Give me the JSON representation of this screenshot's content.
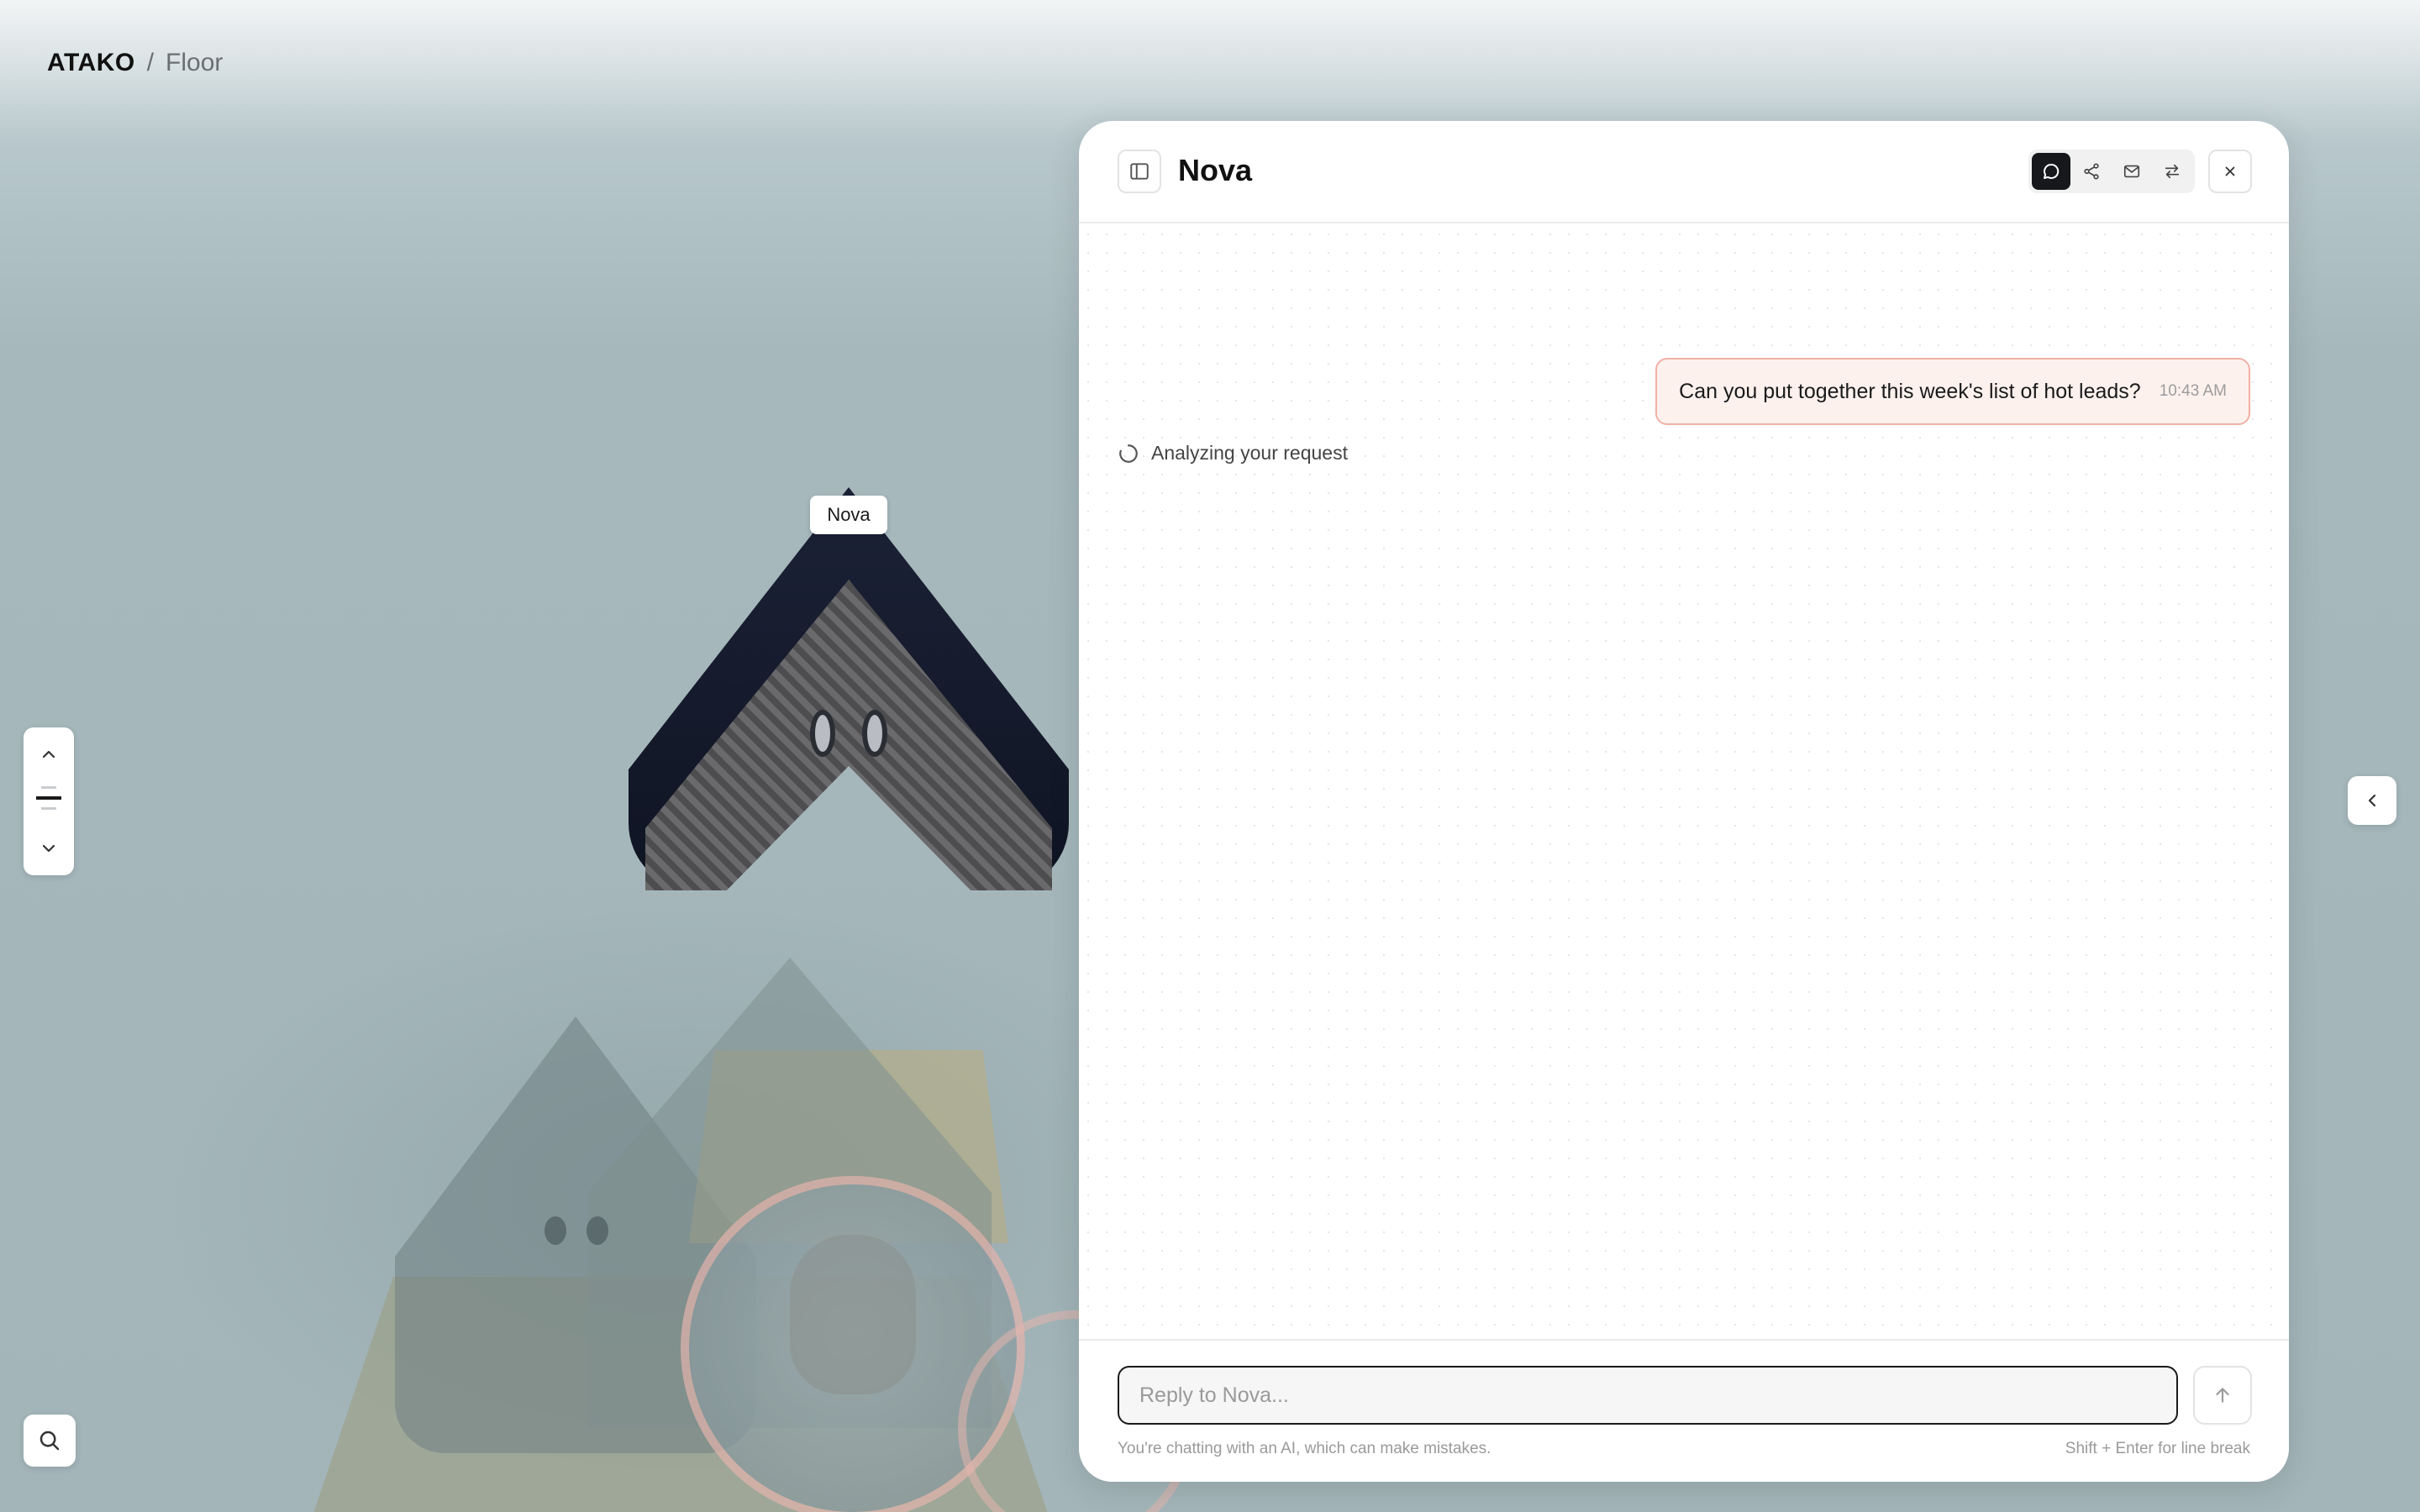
{
  "breadcrumb": {
    "root": "ATAKO",
    "separator": "/",
    "page": "Floor"
  },
  "scene": {
    "robot_label": "Nova"
  },
  "scroll_control": {
    "up_icon": "chevron-up-icon",
    "down_icon": "chevron-down-icon"
  },
  "search": {
    "icon": "search-icon"
  },
  "edge_toggle": {
    "icon": "chevron-left-icon"
  },
  "chat": {
    "title": "Nova",
    "modes": [
      {
        "name": "chat",
        "icon": "chat-bubble-icon",
        "active": true
      },
      {
        "name": "share",
        "icon": "share-icon",
        "active": false
      },
      {
        "name": "mail",
        "icon": "mail-icon",
        "active": false
      },
      {
        "name": "transfer",
        "icon": "swap-arrows-icon",
        "active": false
      }
    ],
    "messages": [
      {
        "role": "user",
        "text": "Can you put together this week's list of hot leads?",
        "time": "10:43 AM"
      }
    ],
    "status": "Analyzing your request",
    "composer": {
      "placeholder": "Reply to Nova...",
      "value": "",
      "disclaimer": "You're chatting with an AI, which can make mistakes.",
      "hint": "Shift + Enter for line break"
    }
  },
  "colors": {
    "accent_dark": "#16181c",
    "user_bubble_bg": "#fdf1ee",
    "user_bubble_border": "#f0b1a6"
  }
}
